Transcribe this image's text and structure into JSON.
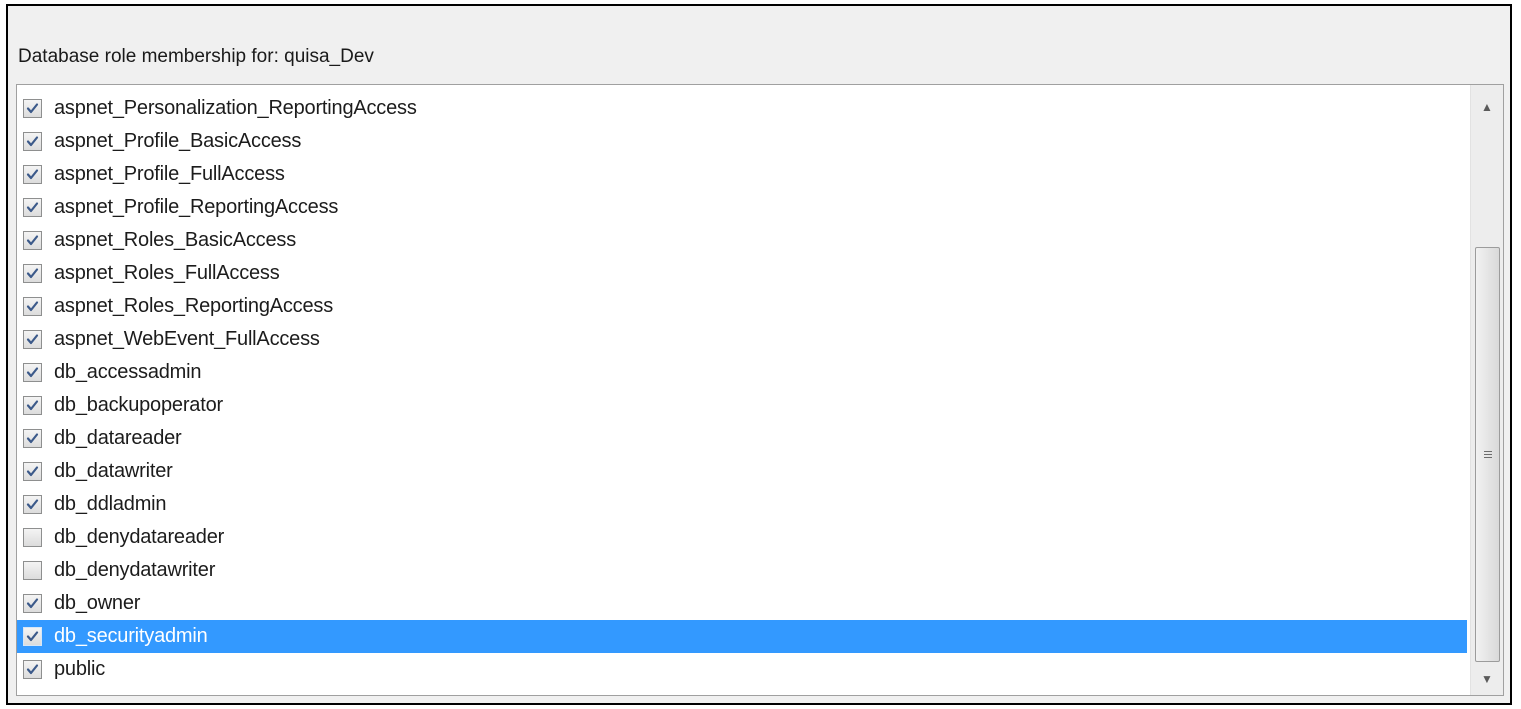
{
  "header": {
    "label": "Database role membership for: quisa_Dev"
  },
  "roles": [
    {
      "name": "aspnet_Personalization_ReportingAccess",
      "checked": true,
      "selected": false
    },
    {
      "name": "aspnet_Profile_BasicAccess",
      "checked": true,
      "selected": false
    },
    {
      "name": "aspnet_Profile_FullAccess",
      "checked": true,
      "selected": false
    },
    {
      "name": "aspnet_Profile_ReportingAccess",
      "checked": true,
      "selected": false
    },
    {
      "name": "aspnet_Roles_BasicAccess",
      "checked": true,
      "selected": false
    },
    {
      "name": "aspnet_Roles_FullAccess",
      "checked": true,
      "selected": false
    },
    {
      "name": "aspnet_Roles_ReportingAccess",
      "checked": true,
      "selected": false
    },
    {
      "name": "aspnet_WebEvent_FullAccess",
      "checked": true,
      "selected": false
    },
    {
      "name": "db_accessadmin",
      "checked": true,
      "selected": false
    },
    {
      "name": "db_backupoperator",
      "checked": true,
      "selected": false
    },
    {
      "name": "db_datareader",
      "checked": true,
      "selected": false
    },
    {
      "name": "db_datawriter",
      "checked": true,
      "selected": false
    },
    {
      "name": "db_ddladmin",
      "checked": true,
      "selected": false
    },
    {
      "name": "db_denydatareader",
      "checked": false,
      "selected": false
    },
    {
      "name": "db_denydatawriter",
      "checked": false,
      "selected": false
    },
    {
      "name": "db_owner",
      "checked": true,
      "selected": false
    },
    {
      "name": "db_securityadmin",
      "checked": true,
      "selected": true
    },
    {
      "name": "public",
      "checked": true,
      "selected": false
    }
  ],
  "scrollbar": {
    "up_icon": "arrow-up-icon",
    "down_icon": "arrow-down-icon",
    "grip_icon": "grip-icon"
  },
  "colors": {
    "selection": "#3399ff",
    "check": "#3c5a8a"
  }
}
